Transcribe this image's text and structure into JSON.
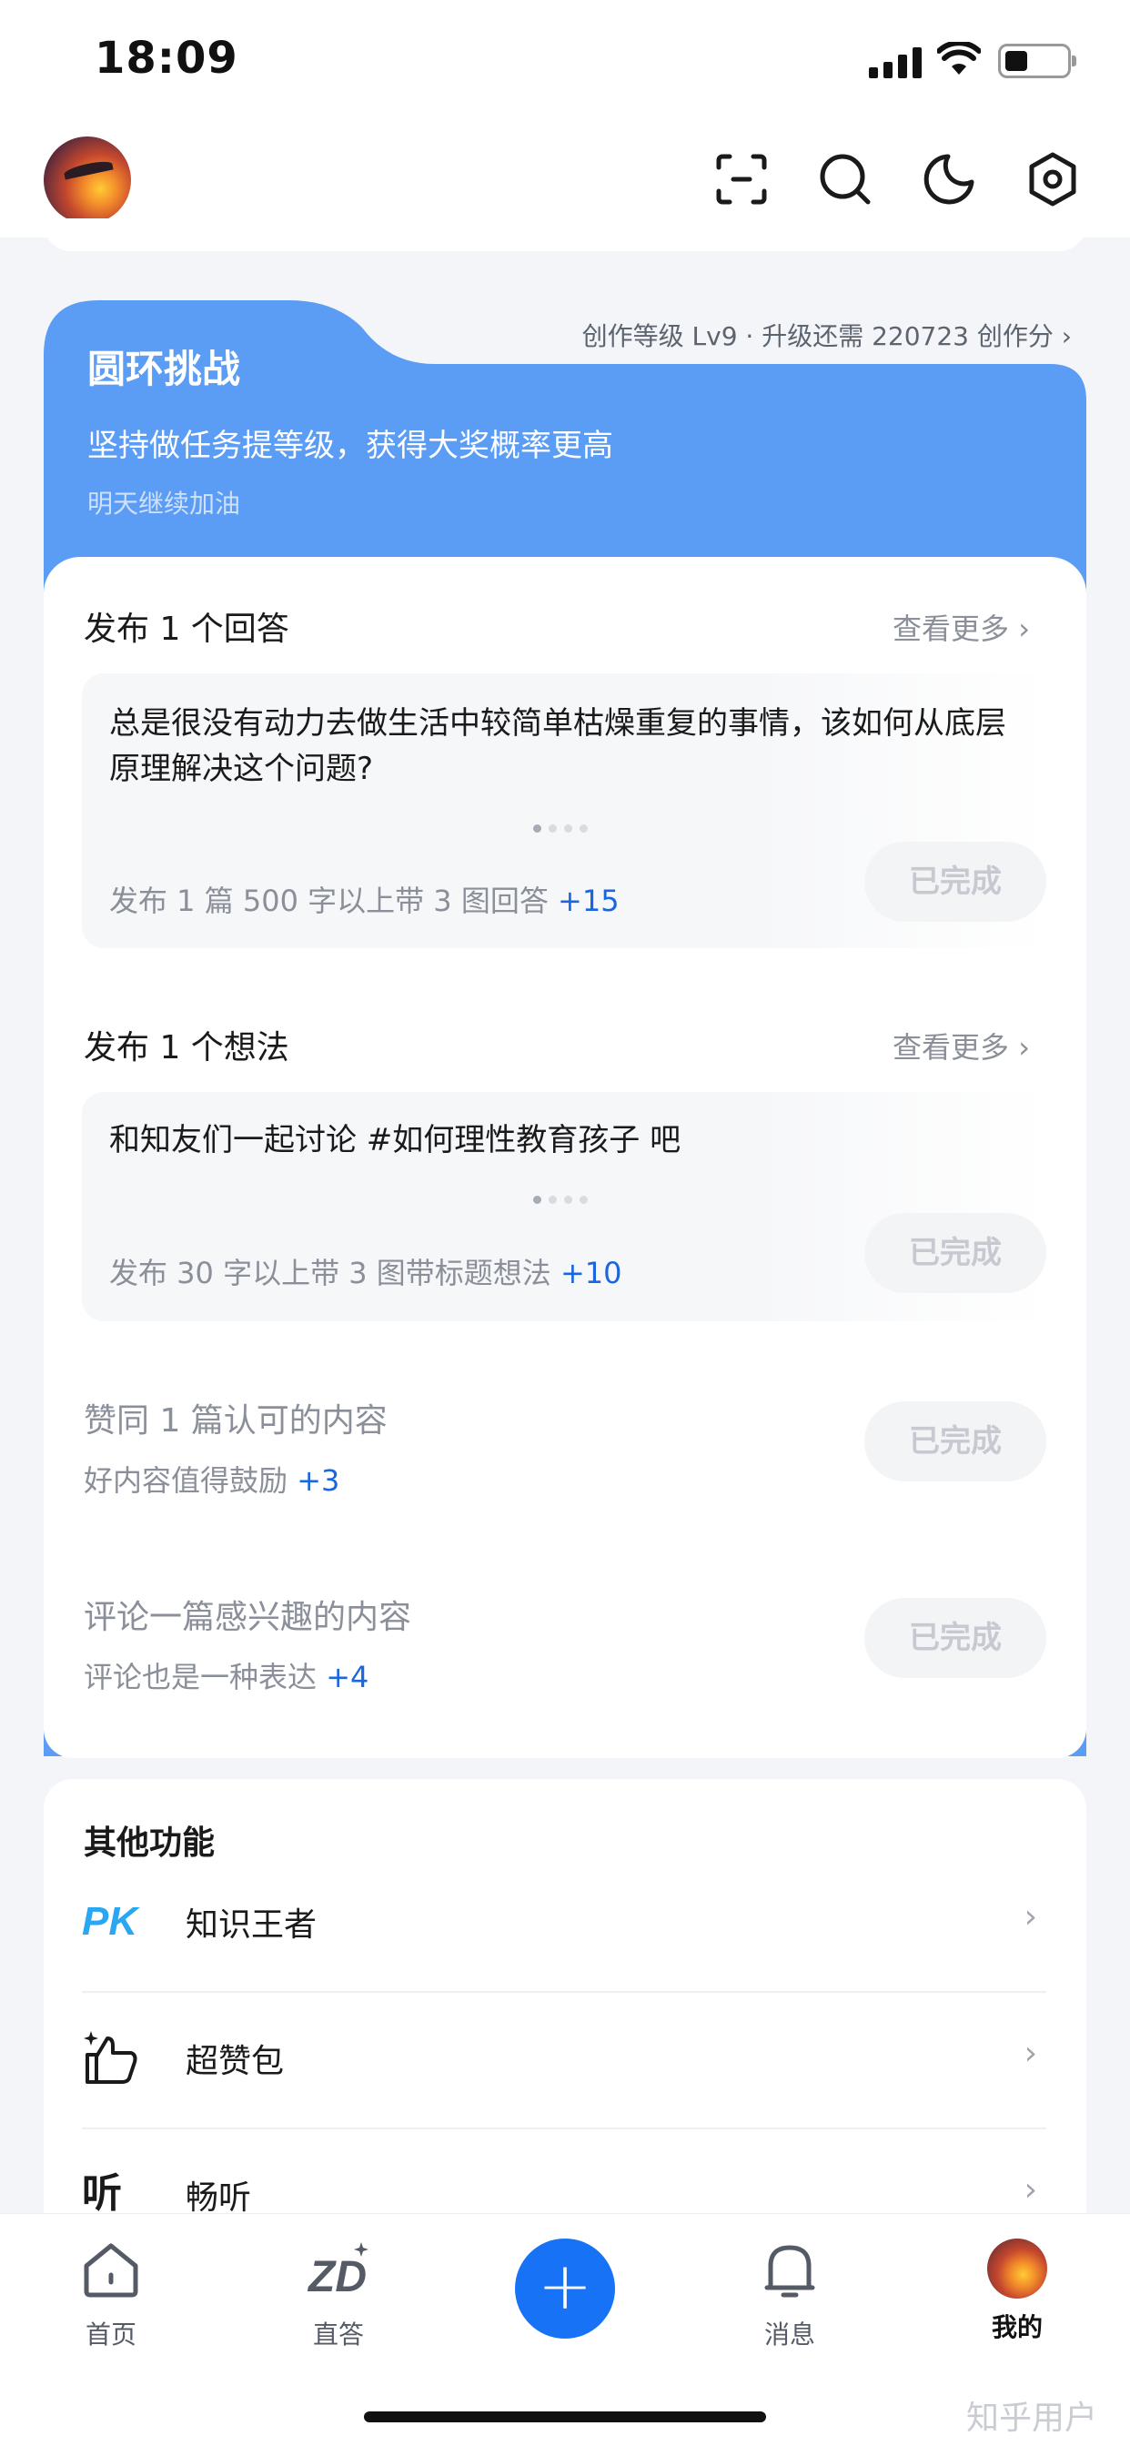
{
  "status_bar": {
    "time": "18:09"
  },
  "header": {
    "icons": [
      "scan-icon",
      "search-icon",
      "night-mode-icon",
      "settings-icon"
    ]
  },
  "challenge": {
    "title": "圆环挑战",
    "level_info": "创作等级 Lv9 · 升级还需 220723 创作分 ›",
    "slogan": "坚持做任务提等级，获得大奖概率更高",
    "sub_slogan": "明天继续加油",
    "accent_color": "#5b9cf5"
  },
  "tasks": [
    {
      "title": "发布 1 个回答",
      "see_more": "查看更多",
      "content": "总是很没有动力去做生活中较简单枯燥重复的事情，该如何从底层原理解决这个问题?",
      "desc": "发布 1 篇 500 字以上带 3 图回答",
      "bonus": "+15",
      "status": "已完成"
    },
    {
      "title": "发布 1 个想法",
      "see_more": "查看更多",
      "content": "和知友们一起讨论 #如何理性教育孩子 吧",
      "desc": "发布 30 字以上带 3 图带标题想法",
      "bonus": "+10",
      "status": "已完成"
    },
    {
      "title": "赞同 1 篇认可的内容",
      "desc": "好内容值得鼓励",
      "bonus": "+3",
      "status": "已完成"
    },
    {
      "title": "评论一篇感兴趣的内容",
      "desc": "评论也是一种表达",
      "bonus": "+4",
      "status": "已完成"
    }
  ],
  "other": {
    "title": "其他功能",
    "items": [
      {
        "label": "知识王者",
        "icon": "pk-icon",
        "icon_text": "PK"
      },
      {
        "label": "超赞包",
        "icon": "thumbs-up-sparkle-icon"
      },
      {
        "label": "畅听",
        "icon": "listen-icon",
        "icon_text": "听"
      }
    ]
  },
  "tab_bar": {
    "items": [
      {
        "label": "首页",
        "icon": "home-icon"
      },
      {
        "label": "直答",
        "icon": "zhida-icon"
      },
      {
        "label": "",
        "icon": "plus-icon",
        "glyph": "+"
      },
      {
        "label": "消息",
        "icon": "bell-icon"
      },
      {
        "label": "我的",
        "icon": "avatar"
      }
    ],
    "active": "我的"
  },
  "watermark": "知乎用户"
}
